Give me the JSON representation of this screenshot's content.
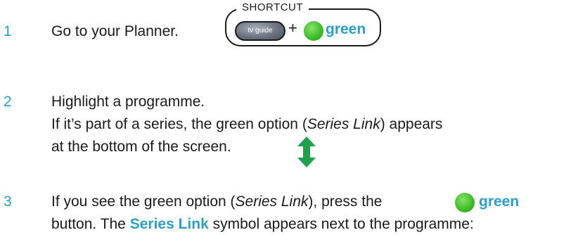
{
  "steps": [
    {
      "number": "1",
      "text": "Go to your Planner."
    },
    {
      "number": "2",
      "line1": "Highlight a programme.",
      "line2_pre": "If it’s part of a series, the green option (",
      "line2_em": "Series Link",
      "line2_post": ") appears",
      "line3": "at the bottom of the screen."
    },
    {
      "number": "3",
      "line1_pre": "If you see the green option (",
      "line1_em": "Series Link",
      "line1_post": "), press the",
      "line1_button": "green",
      "line2_pre": "button. The",
      "line2_bold": "Series Link",
      "line2_post": "symbol appears next to the programme:"
    }
  ],
  "shortcut": {
    "title": "SHORTCUT",
    "tv_guide_label": "tv guide",
    "plus": "+",
    "green_label": "green"
  },
  "colors": {
    "accent_blue": "#2aa0c8",
    "green_button": "#3fbf2a",
    "arrow_green": "#1aa34a"
  },
  "icons": [
    "green-button-icon",
    "tv-guide-button-icon",
    "up-down-arrow-icon"
  ]
}
